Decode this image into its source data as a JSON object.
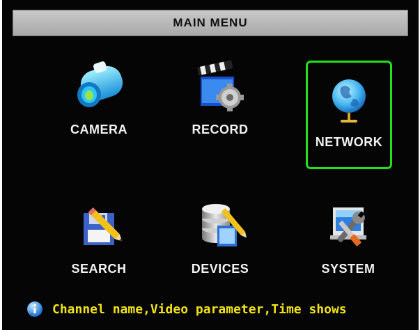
{
  "title": "MAIN MENU",
  "menu": {
    "camera": {
      "label": "CAMERA",
      "icon": "camera-icon"
    },
    "record": {
      "label": "RECORD",
      "icon": "record-icon"
    },
    "network": {
      "label": "NETWORK",
      "icon": "network-icon",
      "selected": true
    },
    "search": {
      "label": "SEARCH",
      "icon": "search-icon"
    },
    "devices": {
      "label": "DEVICES",
      "icon": "devices-icon"
    },
    "system": {
      "label": "SYSTEM",
      "icon": "system-icon"
    }
  },
  "status_text": "Channel name,Video parameter,Time shows",
  "colors": {
    "background": "#050505",
    "selection": "#22e01c",
    "status_text": "#f0e21a",
    "title_bar": "#b9b9b9"
  }
}
